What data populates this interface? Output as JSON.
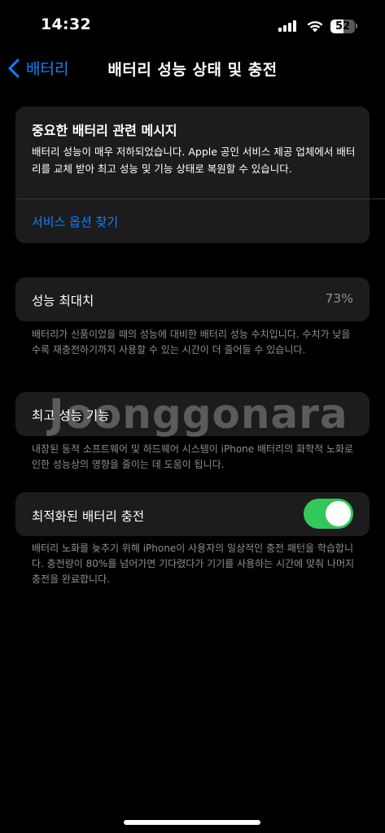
{
  "status_bar": {
    "time": "14:32",
    "battery_level": "52"
  },
  "nav": {
    "back_label": "배터리",
    "title": "배터리 성능 상태 및 충전"
  },
  "message": {
    "title": "중요한 배터리 관련 메시지",
    "body": "배터리 성능이 매우 저하되었습니다. Apple 공인 서비스 제공 업체에서 배터리를 교체 받아 최고 성능 및 기능 상태로 복원할 수 있습니다.",
    "link": "서비스 옵션 찾기"
  },
  "max_capacity": {
    "label": "성능 최대치",
    "value": "73%",
    "footnote": "배터리가 신품이었을 때의 성능에 대비한 배터리 성능 수치입니다. 수치가 낮을수록 재충전하기까지 사용할 수 있는 시간이 더 줄어들 수 있습니다."
  },
  "peak_performance": {
    "label": "최고 성능 기능",
    "footnote": "내장된 동적 소프트웨어 및 하드웨어 시스템이 iPhone 배터리의 화학적 노화로 인한 성능상의 영향을 줄이는 데 도움이 됩니다."
  },
  "optimized_charging": {
    "label": "최적화된 배터리 충전",
    "enabled": true,
    "footnote": "배터리 노화를 늦추기 위해 iPhone이 사용자의 일상적인 충전 패턴을 학습합니다. 충전량이 80%를 넘어가면 기다렸다가 기기를 사용하는 시간에 맞춰 나머지 충전을 완료합니다."
  },
  "watermark": "Joonggonara",
  "colors": {
    "accent": "#0a84ff",
    "toggle_on": "#34c759",
    "card_bg": "#1c1c1e",
    "secondary_text": "#8e8e93"
  }
}
